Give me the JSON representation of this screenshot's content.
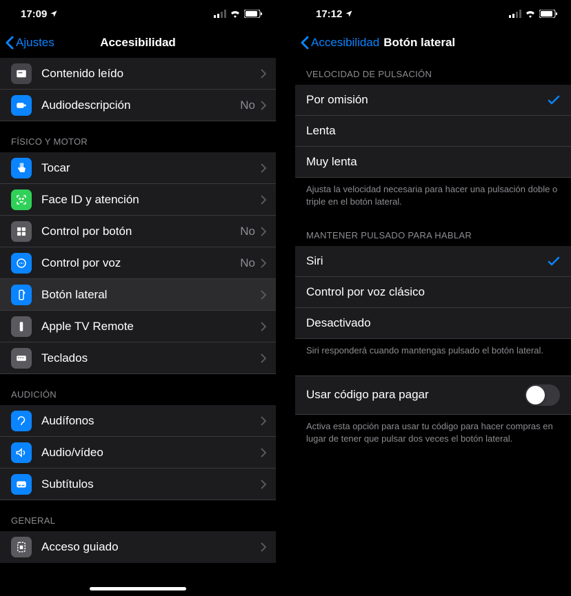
{
  "left": {
    "status": {
      "time": "17:09"
    },
    "nav": {
      "back": "Ajustes",
      "title": "Accesibilidad"
    },
    "top_rows": [
      {
        "label": "Contenido leído",
        "value": ""
      },
      {
        "label": "Audiodescripción",
        "value": "No"
      }
    ],
    "sections": [
      {
        "header": "FÍSICO Y MOTOR",
        "rows": [
          {
            "label": "Tocar",
            "value": ""
          },
          {
            "label": "Face ID y atención",
            "value": ""
          },
          {
            "label": "Control por botón",
            "value": "No"
          },
          {
            "label": "Control por voz",
            "value": "No"
          },
          {
            "label": "Botón lateral",
            "value": ""
          },
          {
            "label": "Apple TV Remote",
            "value": ""
          },
          {
            "label": "Teclados",
            "value": ""
          }
        ]
      },
      {
        "header": "AUDICIÓN",
        "rows": [
          {
            "label": "Audífonos",
            "value": ""
          },
          {
            "label": "Audio/vídeo",
            "value": ""
          },
          {
            "label": "Subtítulos",
            "value": ""
          }
        ]
      },
      {
        "header": "GENERAL",
        "rows": [
          {
            "label": "Acceso guiado",
            "value": ""
          }
        ]
      }
    ]
  },
  "right": {
    "status": {
      "time": "17:12"
    },
    "nav": {
      "back": "Accesibilidad",
      "title": "Botón lateral"
    },
    "sections": [
      {
        "header": "VELOCIDAD DE PULSACIÓN",
        "rows": [
          {
            "label": "Por omisión",
            "checked": true
          },
          {
            "label": "Lenta",
            "checked": false
          },
          {
            "label": "Muy lenta",
            "checked": false
          }
        ],
        "footer": "Ajusta la velocidad necesaria para hacer una pulsación doble o triple en el botón lateral."
      },
      {
        "header": "MANTENER PULSADO PARA HABLAR",
        "rows": [
          {
            "label": "Siri",
            "checked": true
          },
          {
            "label": "Control por voz clásico",
            "checked": false
          },
          {
            "label": "Desactivado",
            "checked": false
          }
        ],
        "footer": "Siri responderá cuando mantengas pulsado el botón lateral."
      }
    ],
    "toggle_row": {
      "label": "Usar código para pagar",
      "on": false
    },
    "toggle_footer": "Activa esta opción para usar tu código para hacer compras en lugar de tener que pulsar dos veces el botón lateral."
  }
}
